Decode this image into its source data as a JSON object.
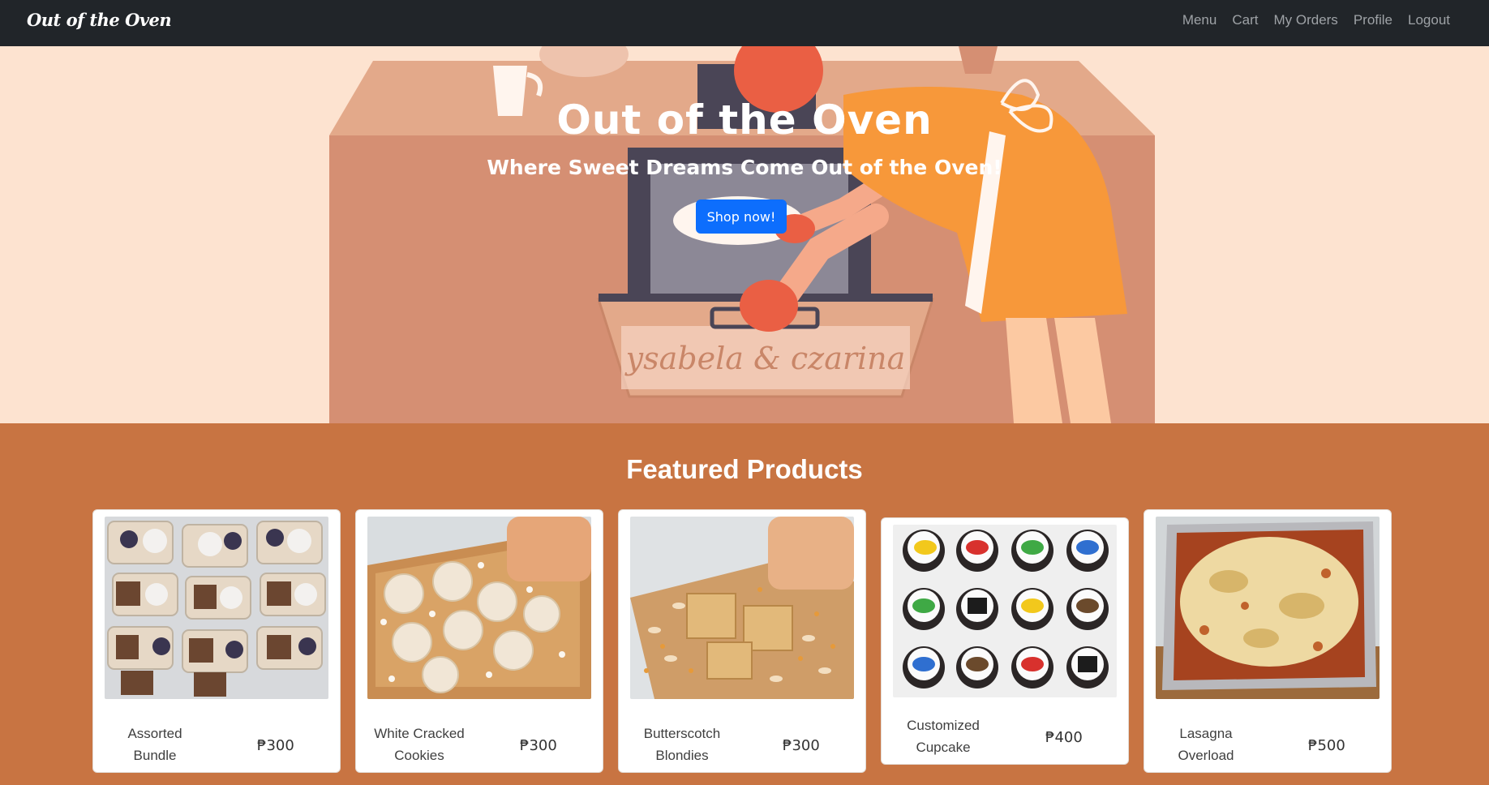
{
  "navbar": {
    "brand": "Out of the Oven",
    "links": [
      "Menu",
      "Cart",
      "My Orders",
      "Profile",
      "Logout"
    ]
  },
  "hero": {
    "title": "Out of the Oven",
    "subtitle": "Where Sweet Dreams Come Out of the Oven!",
    "cta_label": "Shop now!",
    "drawer_signature": "ysabela & czarina"
  },
  "featured": {
    "heading": "Featured Products",
    "products": [
      {
        "name_line1": "Assorted",
        "name_line2": "Bundle",
        "price": "₱300"
      },
      {
        "name_line1": "White Cracked",
        "name_line2": "Cookies",
        "price": "₱300"
      },
      {
        "name_line1": "Butterscotch",
        "name_line2": "Blondies",
        "price": "₱300"
      },
      {
        "name_line1": "Customized",
        "name_line2": "Cupcake",
        "price": "₱400"
      },
      {
        "name_line1": "Lasagna",
        "name_line2": "Overload",
        "price": "₱500"
      }
    ]
  },
  "colors": {
    "navbar_bg": "#212529",
    "hero_bg": "#fde3d0",
    "featured_bg": "#c87442",
    "button_primary": "#0d6efd"
  }
}
